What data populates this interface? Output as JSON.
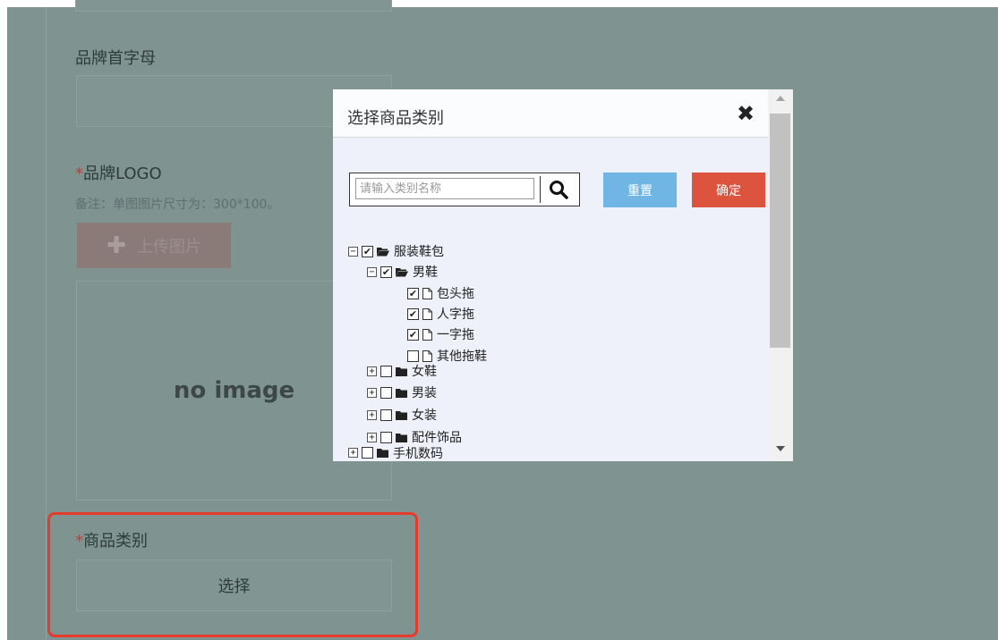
{
  "form": {
    "brand_initial_label": "品牌首字母",
    "brand_logo_required_mark": "*",
    "brand_logo_label": "品牌LOGO",
    "brand_logo_note": "备注：单图图片尺寸为：300*100。",
    "upload_button_label": "上传图片",
    "no_image_text": "no image",
    "category_required_mark": "*",
    "category_label": "商品类别",
    "select_button_label": "选择"
  },
  "dialog": {
    "title": "选择商品类别",
    "close_icon": "close-icon",
    "search_placeholder": "请输入类别名称",
    "reset_label": "重置",
    "confirm_label": "确定"
  },
  "tree": {
    "nodes": [
      {
        "label": "服装鞋包",
        "checked": true,
        "expanded": true,
        "type": "folder-open"
      },
      {
        "label": "男鞋",
        "checked": true,
        "expanded": true,
        "type": "folder-open"
      },
      {
        "label": "包头拖",
        "checked": true,
        "type": "file"
      },
      {
        "label": "人字拖",
        "checked": true,
        "type": "file"
      },
      {
        "label": "一字拖",
        "checked": true,
        "type": "file"
      },
      {
        "label": "其他拖鞋",
        "checked": false,
        "type": "file"
      },
      {
        "label": "女鞋",
        "checked": false,
        "expanded": false,
        "type": "folder"
      },
      {
        "label": "男装",
        "checked": false,
        "expanded": false,
        "type": "folder"
      },
      {
        "label": "女装",
        "checked": false,
        "expanded": false,
        "type": "folder"
      },
      {
        "label": "配件饰品",
        "checked": false,
        "expanded": false,
        "type": "folder"
      },
      {
        "label": "手机数码",
        "checked": false,
        "expanded": false,
        "type": "folder"
      }
    ]
  },
  "colors": {
    "overlay": "#7f9391",
    "reset_button": "#6fb6e4",
    "confirm_button": "#dc533e",
    "highlight_border": "#e53a2c"
  }
}
